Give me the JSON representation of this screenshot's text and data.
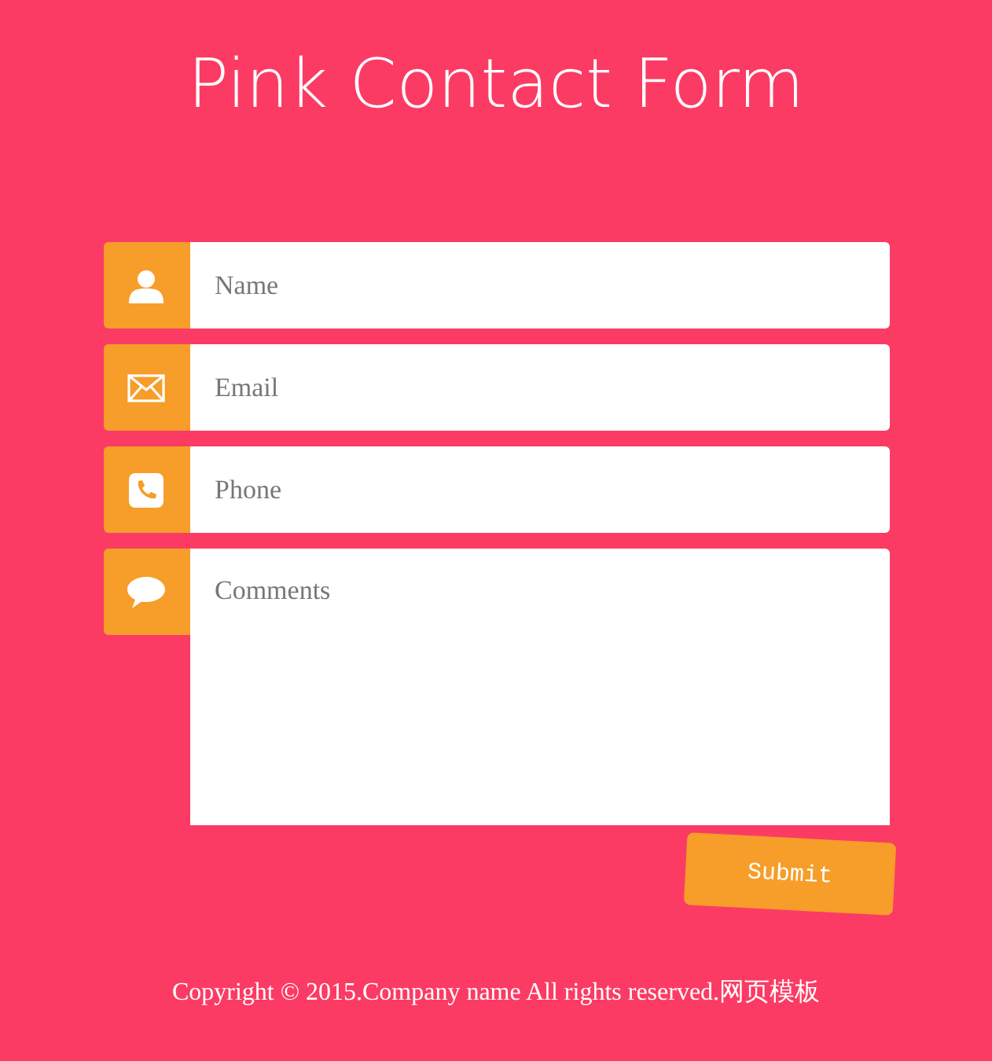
{
  "title": "Pink Contact Form",
  "fields": [
    {
      "kind": "input",
      "placeholder": "Name"
    },
    {
      "kind": "input",
      "placeholder": "Email"
    },
    {
      "kind": "input",
      "placeholder": "Phone"
    },
    {
      "kind": "textarea",
      "placeholder": "Comments"
    }
  ],
  "submit": "Submit",
  "footer": "Copyright © 2015.Company name All rights reserved.网页模板"
}
